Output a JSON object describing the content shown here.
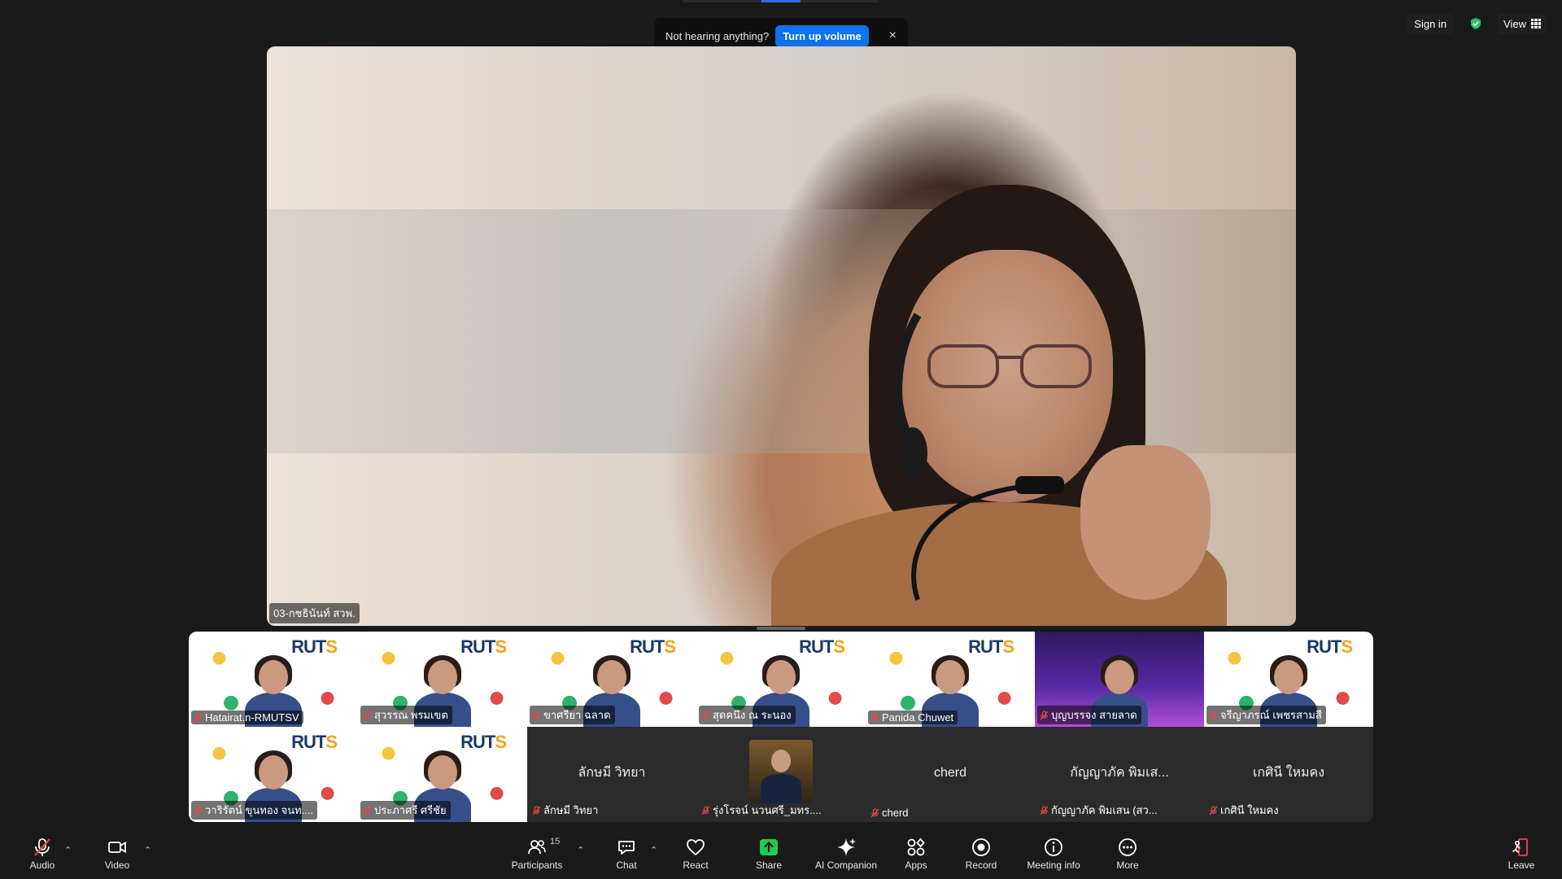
{
  "notice": {
    "message": "Not hearing anything?",
    "button": "Turn up volume",
    "close": "×"
  },
  "topbar": {
    "sign_in": "Sign in",
    "view": "View"
  },
  "main_video": {
    "name": "03-กชธินันท์ สวพ."
  },
  "gallery": [
    {
      "name": "Hatairat.n-RMUTSV",
      "style": "video"
    },
    {
      "name": "สุวรรณ พรมเขต",
      "style": "video"
    },
    {
      "name": "ขาศรียา ฉลาด",
      "style": "video"
    },
    {
      "name": "สุดคนึง ณ ระนอง",
      "style": "video"
    },
    {
      "name": "Panida Chuwet",
      "style": "video"
    },
    {
      "name": "บุญบรรจง สายลาด",
      "style": "purple"
    },
    {
      "name": "จรีญาภรณ์ เพชรสามสี",
      "style": "video"
    },
    {
      "name": "วาริรัตน์ ขุนทอง จนท....",
      "style": "video"
    },
    {
      "name": "ประภาศรี ศรีชัย",
      "style": "video"
    },
    {
      "name": "ลักษมี วิทยา",
      "center": "ลักษมี วิทยา",
      "style": "dark"
    },
    {
      "name": "รุ่งโรจน์ นวนศรี_มทร....",
      "style": "avatar"
    },
    {
      "name": "cherd",
      "center": "cherd",
      "style": "dark"
    },
    {
      "name": "กัญญาภัค พิมเสน (สว...",
      "center": "กัญญาภัค พิมเส...",
      "style": "dark"
    },
    {
      "name": "เกศินี ใหมคง",
      "center": "เกศินี ใหมคง",
      "style": "dark"
    }
  ],
  "toolbar": {
    "audio": "Audio",
    "video": "Video",
    "participants": "Participants",
    "participants_count": "15",
    "chat": "Chat",
    "react": "React",
    "share": "Share",
    "ai_companion": "AI Companion",
    "apps": "Apps",
    "record": "Record",
    "meeting_info": "Meeting info",
    "more": "More",
    "leave": "Leave"
  },
  "colors": {
    "accent": "#0e72ed",
    "share_green": "#1fcc54",
    "secure_green": "#22c55e",
    "leave_red": "#e5484d"
  }
}
